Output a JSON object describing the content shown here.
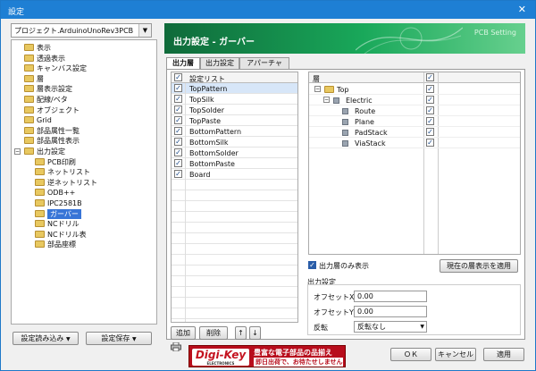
{
  "window": {
    "title": "設定",
    "close_glyph": "✕"
  },
  "project": {
    "selected": "プロジェクト.ArduinoUnoRev3PCB"
  },
  "tree": {
    "items": [
      {
        "label": "表示",
        "level": 1
      },
      {
        "label": "透過表示",
        "level": 1
      },
      {
        "label": "キャンバス設定",
        "level": 1
      },
      {
        "label": "層",
        "level": 1
      },
      {
        "label": "層表示設定",
        "level": 1
      },
      {
        "label": "配線/ベタ",
        "level": 1
      },
      {
        "label": "オブジェクト",
        "level": 1
      },
      {
        "label": "Grid",
        "level": 1
      },
      {
        "label": "部品属性一覧",
        "level": 1
      },
      {
        "label": "部品属性表示",
        "level": 1
      },
      {
        "label": "出力設定",
        "level": 1,
        "expanded": true
      },
      {
        "label": "PCB印刷",
        "level": 2
      },
      {
        "label": "ネットリスト",
        "level": 2
      },
      {
        "label": "逆ネットリスト",
        "level": 2
      },
      {
        "label": "ODB++",
        "level": 2
      },
      {
        "label": "IPC2581B",
        "level": 2
      },
      {
        "label": "ガーバー",
        "level": 2,
        "selected": true
      },
      {
        "label": "NCドリル",
        "level": 2
      },
      {
        "label": "NCドリル表",
        "level": 2
      },
      {
        "label": "部品座標",
        "level": 2
      }
    ],
    "collapse_glyph": "−"
  },
  "left_buttons": {
    "load": "設定読み込み",
    "save": "設定保存",
    "arrow": "▼"
  },
  "banner": {
    "title": "出力設定 - ガーバー",
    "subtitle": "PCB Setting"
  },
  "tabs": [
    {
      "label": "出力層",
      "active": true
    },
    {
      "label": "出力設定"
    },
    {
      "label": "アパーチャ"
    }
  ],
  "output_list": {
    "header": "設定リスト",
    "rows": [
      {
        "name": "TopPattern",
        "checked": true,
        "selected": true
      },
      {
        "name": "TopSilk",
        "checked": true
      },
      {
        "name": "TopSolder",
        "checked": true
      },
      {
        "name": "TopPaste",
        "checked": true
      },
      {
        "name": "BottomPattern",
        "checked": true
      },
      {
        "name": "BottomSilk",
        "checked": true
      },
      {
        "name": "BottomSolder",
        "checked": true
      },
      {
        "name": "BottomPaste",
        "checked": true
      },
      {
        "name": "Board",
        "checked": true
      }
    ],
    "check_glyph": "✓",
    "add": "追加",
    "delete": "削除",
    "up": "↑",
    "down": "↓"
  },
  "layer_table": {
    "header": "層",
    "rows": [
      {
        "name": "Top",
        "level": 0,
        "kind": "folder",
        "checked": true
      },
      {
        "name": "Electric",
        "level": 1,
        "kind": "chip",
        "checked": true
      },
      {
        "name": "Route",
        "level": 2,
        "kind": "chip",
        "checked": true
      },
      {
        "name": "Plane",
        "level": 2,
        "kind": "chip",
        "checked": true
      },
      {
        "name": "PadStack",
        "level": 2,
        "kind": "chip",
        "checked": true
      },
      {
        "name": "ViaStack",
        "level": 2,
        "kind": "chip",
        "checked": true
      }
    ]
  },
  "options": {
    "only_output_layers": "出力層のみ表示",
    "only_output_layers_checked": true,
    "apply_current": "現在の層表示を適用",
    "section": "出力設定",
    "offset_x_label": "オフセットX",
    "offset_x": "0.00",
    "offset_y_label": "オフセットY",
    "offset_y": "0.00",
    "invert_label": "反転",
    "invert_value": "反転なし"
  },
  "footer": {
    "ok": "ＯＫ",
    "cancel": "キャンセル",
    "apply": "適用",
    "ad_logo": "Digi-Key",
    "ad_logo_sub": "ELECTRONICS",
    "ad_line1": "豊富な電子部品の品揃え",
    "ad_line2": "即日出荷で、お待たせしません!"
  },
  "colors": {
    "title": "#1e7fd4",
    "banner": "#19a85a",
    "selection": "#3875d7"
  }
}
